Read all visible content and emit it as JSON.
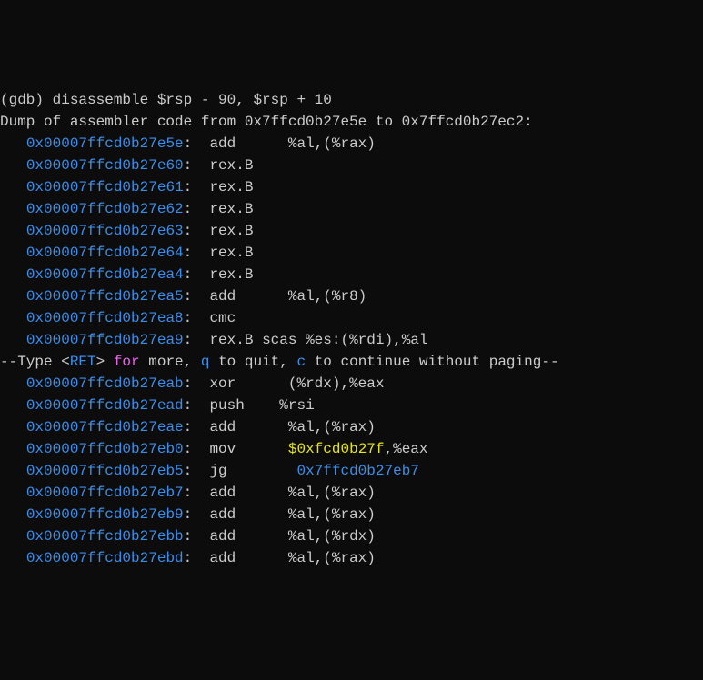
{
  "prompt": {
    "gdb_open": "(gdb) ",
    "cmd": "disassemble $rsp - 90, $rsp + 10"
  },
  "dump_header": {
    "prefix": "Dump of assembler code from ",
    "from": "0x7ffcd0b27e5e",
    "mid": " to ",
    "to": "0x7ffcd0b27ec2",
    "suffix": ":"
  },
  "rows": [
    {
      "addr": "0x00007ffcd0b27e5e",
      "mnemonic": "add",
      "operands": "   %al,(%rax)"
    },
    {
      "addr": "0x00007ffcd0b27e60",
      "mnemonic": "rex.B",
      "operands": ""
    },
    {
      "addr": "0x00007ffcd0b27e61",
      "mnemonic": "rex.B",
      "operands": ""
    },
    {
      "addr": "0x00007ffcd0b27e62",
      "mnemonic": "rex.B",
      "operands": ""
    },
    {
      "addr": "0x00007ffcd0b27e63",
      "mnemonic": "rex.B",
      "operands": ""
    },
    {
      "addr": "0x00007ffcd0b27e64",
      "mnemonic": "rex.B",
      "operands": ""
    },
    {
      "addr": "0x00007ffcd0b27ea4",
      "mnemonic": "rex.B",
      "operands": ""
    },
    {
      "addr": "0x00007ffcd0b27ea5",
      "mnemonic": "add",
      "operands": "   %al,(%r8)"
    },
    {
      "addr": "0x00007ffcd0b27ea8",
      "mnemonic": "cmc",
      "operands": ""
    },
    {
      "addr": "0x00007ffcd0b27ea9",
      "mnemonic": "rex.B scas %es:(%rdi),%al",
      "operands": ""
    }
  ],
  "pager": {
    "p1": "--Type <",
    "ret": "RET",
    "p2": "> ",
    "for_kw": "for",
    "p3": " more, ",
    "q": "q",
    "p4": " to quit, ",
    "c": "c",
    "p5": " to continue without paging--"
  },
  "rows2": [
    {
      "addr": "0x00007ffcd0b27eab",
      "mnemonic": "xor",
      "operands": "   (%rdx),%eax"
    },
    {
      "addr": "0x00007ffcd0b27ead",
      "mnemonic": "push",
      "operands": "  %rsi"
    },
    {
      "addr": "0x00007ffcd0b27eae",
      "mnemonic": "add",
      "operands": "   %al,(%rax)"
    },
    {
      "addr": "0x00007ffcd0b27eb0",
      "mnemonic": "mov",
      "operands_prefix": "   ",
      "imm": "$0xfcd0b27f",
      "operands_suffix": ",%eax"
    },
    {
      "addr": "0x00007ffcd0b27eb5",
      "mnemonic": "jg",
      "operands_prefix": "    ",
      "target": "0x7ffcd0b27eb7"
    },
    {
      "addr": "0x00007ffcd0b27eb7",
      "mnemonic": "add",
      "operands": "   %al,(%rax)"
    },
    {
      "addr": "0x00007ffcd0b27eb9",
      "mnemonic": "add",
      "operands": "   %al,(%rax)"
    },
    {
      "addr": "0x00007ffcd0b27ebb",
      "mnemonic": "add",
      "operands": "   %al,(%rdx)"
    },
    {
      "addr": "0x00007ffcd0b27ebd",
      "mnemonic": "add",
      "operands": "   %al,(%rax)"
    }
  ],
  "indent": "   ",
  "colon_space": ":  "
}
